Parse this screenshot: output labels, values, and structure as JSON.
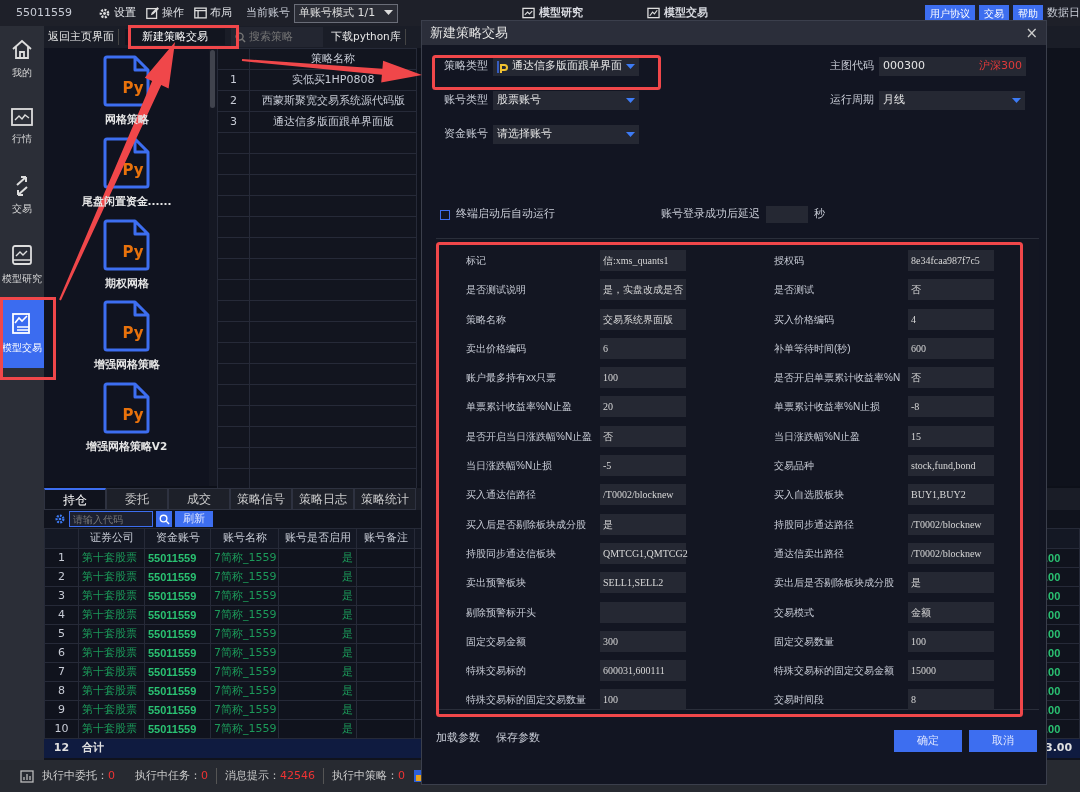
{
  "top_bar": {
    "account": "55011559",
    "menus": [
      {
        "label": "设置"
      },
      {
        "label": "操作"
      },
      {
        "label": "布局"
      }
    ],
    "current_account_label": "当前账号",
    "account_mode": "单账号模式 1/1",
    "center_tabs": [
      {
        "label": "模型研究"
      },
      {
        "label": "模型交易"
      }
    ],
    "buttons": [
      "用户协议",
      "交易",
      "帮助"
    ],
    "data_date_label": "数据日"
  },
  "sidebar": {
    "items": [
      {
        "label": "我的",
        "selected": false
      },
      {
        "label": "行情",
        "selected": false
      },
      {
        "label": "交易",
        "selected": false
      },
      {
        "label": "模型研究",
        "selected": false
      },
      {
        "label": "模型交易",
        "selected": true
      }
    ]
  },
  "strategy_panel": {
    "toolbar": {
      "back": "返回主页界面",
      "new": "新建策略交易",
      "search_placeholder": "搜索策略",
      "download": "下载python库"
    },
    "templates": [
      {
        "icon_text": "Py",
        "label": "网格策略"
      },
      {
        "icon_text": "Py",
        "label": "尾盘闲置资金......"
      },
      {
        "icon_text": "Py",
        "label": "期权网格"
      },
      {
        "icon_text": "Py",
        "label": "增强网格策略"
      },
      {
        "icon_text": "Py",
        "label": "增强网格策略V2"
      }
    ],
    "table": {
      "columns": [
        "策略名称"
      ],
      "rows": [
        {
          "num": "1",
          "name": "实低买1HP0808"
        },
        {
          "num": "2",
          "name": "西蒙斯聚宽交易系统源代码版"
        },
        {
          "num": "3",
          "name": "通达信多版面跟单界面版"
        }
      ]
    }
  },
  "bottom_panel": {
    "tabs": [
      {
        "label": "持仓",
        "selected": true
      },
      {
        "label": "委托",
        "selected": false
      },
      {
        "label": "成交",
        "selected": false
      },
      {
        "label": "策略信号",
        "selected": false
      },
      {
        "label": "策略日志",
        "selected": false
      },
      {
        "label": "策略统计",
        "selected": false
      }
    ],
    "search_placeholder": "请输入代码",
    "refresh": "刷新",
    "table": {
      "columns": [
        "证券公司",
        "资金账号",
        "账号名称",
        "账号是否启用",
        "账号备注"
      ],
      "rows": [
        {
          "num": "1",
          "broker": "第十套股票",
          "account": "55011559",
          "name": "7简称_1559",
          "enabled": "是",
          "column_7": ".00"
        },
        {
          "num": "2",
          "broker": "第十套股票",
          "account": "55011559",
          "name": "7简称_1559",
          "enabled": "是",
          "column_7": ".00"
        },
        {
          "num": "3",
          "broker": "第十套股票",
          "account": "55011559",
          "name": "7简称_1559",
          "enabled": "是",
          "column_7": ".00"
        },
        {
          "num": "4",
          "broker": "第十套股票",
          "account": "55011559",
          "name": "7简称_1559",
          "enabled": "是",
          "column_7": ".00"
        },
        {
          "num": "5",
          "broker": "第十套股票",
          "account": "55011559",
          "name": "7简称_1559",
          "enabled": "是",
          "column_7": ".00"
        },
        {
          "num": "6",
          "broker": "第十套股票",
          "account": "55011559",
          "name": "7简称_1559",
          "enabled": "是",
          "column_7": ".00"
        },
        {
          "num": "7",
          "broker": "第十套股票",
          "account": "55011559",
          "name": "7简称_1559",
          "enabled": "是",
          "column_7": ".00"
        },
        {
          "num": "8",
          "broker": "第十套股票",
          "account": "55011559",
          "name": "7简称_1559",
          "enabled": "是",
          "column_7": ".00"
        },
        {
          "num": "9",
          "broker": "第十套股票",
          "account": "55011559",
          "name": "7简称_1559",
          "enabled": "是",
          "column_7": ".00"
        },
        {
          "num": "10",
          "broker": "第十套股票",
          "account": "55011559",
          "name": "7简称_1559",
          "enabled": "是",
          "column_7": ".00"
        }
      ],
      "total": {
        "num": "12",
        "label": "合计",
        "column_7": "3.00"
      }
    }
  },
  "status_bar": {
    "items": [
      {
        "label": "执行中委托：",
        "value": "0"
      },
      {
        "label": "执行中任务：",
        "value": "0"
      },
      {
        "label": "消息提示：",
        "value": "42546"
      },
      {
        "label": "执行中策略：",
        "value": "0"
      }
    ]
  },
  "dialog": {
    "title": "新建策略交易",
    "close": "×",
    "strategy_type": {
      "label": "策略类型",
      "value": "通达信多版面跟单界面"
    },
    "account_type": {
      "label": "账号类型",
      "value": "股票账号"
    },
    "fund_account": {
      "label": "资金账号",
      "value": "请选择账号"
    },
    "chart_code": {
      "label": "主图代码",
      "value": "000300",
      "name": "沪深300"
    },
    "period": {
      "label": "运行周期",
      "value": "月线"
    },
    "auto_run": {
      "label": "终端启动后自动运行",
      "checked": false
    },
    "delay": {
      "label": "账号登录成功后延迟",
      "unit": "秒"
    },
    "params": [
      {
        "label": "标记",
        "value": "信:xms_quants1"
      },
      {
        "label": "授权码",
        "value": "8e34fcaa987f7c5"
      },
      {
        "label": "是否测试说明",
        "value": "是，实盘改成是否"
      },
      {
        "label": "是否测试",
        "value": "否"
      },
      {
        "label": "策略名称",
        "value": "交易系统界面版"
      },
      {
        "label": "买入价格编码",
        "value": "4"
      },
      {
        "label": "卖出价格编码",
        "value": "6"
      },
      {
        "label": "补单等待时间(秒)",
        "value": "600"
      },
      {
        "label": "账户最多持有xx只票",
        "value": "100"
      },
      {
        "label": "是否开启单票累计收益率%N",
        "value": "否"
      },
      {
        "label": "单票累计收益率%N止盈",
        "value": "20"
      },
      {
        "label": "单票累计收益率%N止损",
        "value": "-8"
      },
      {
        "label": "是否开启当日涨跌幅%N止盈",
        "value": "否"
      },
      {
        "label": "当日涨跌幅%N止盈",
        "value": "15"
      },
      {
        "label": "当日涨跌幅%N止损",
        "value": "-5"
      },
      {
        "label": "交易品种",
        "value": "stock,fund,bond"
      },
      {
        "label": "买入通达信路径",
        "value": "/T0002/blocknew"
      },
      {
        "label": "买入自选股板块",
        "value": "BUY1,BUY2"
      },
      {
        "label": "买入后是否剔除板块成分股",
        "value": "是"
      },
      {
        "label": "持股同步通达路径",
        "value": "/T0002/blocknew"
      },
      {
        "label": "持股同步通达信板块",
        "value": "QMTCG1,QMTCG2"
      },
      {
        "label": "通达信卖出路径",
        "value": "/T0002/blocknew"
      },
      {
        "label": "卖出预警板块",
        "value": "SELL1,SELL2"
      },
      {
        "label": "卖出后是否剔除板块成分股",
        "value": "是"
      },
      {
        "label": "剔除预警标开头"
      },
      {
        "label": "交易模式",
        "value": "金额"
      },
      {
        "label": "固定交易金额",
        "value": "300"
      },
      {
        "label": "固定交易数量",
        "value": "100"
      },
      {
        "label": "特殊交易标的",
        "value": "600031,600111"
      },
      {
        "label": "特殊交易标的固定交易金额",
        "value": "15000"
      },
      {
        "label": "特殊交易标的固定交易数量",
        "value": "100"
      },
      {
        "label": "交易时间段",
        "value": "8"
      }
    ],
    "links": [
      "加载参数",
      "保存参数"
    ],
    "ok": "确定",
    "cancel": "取消"
  }
}
